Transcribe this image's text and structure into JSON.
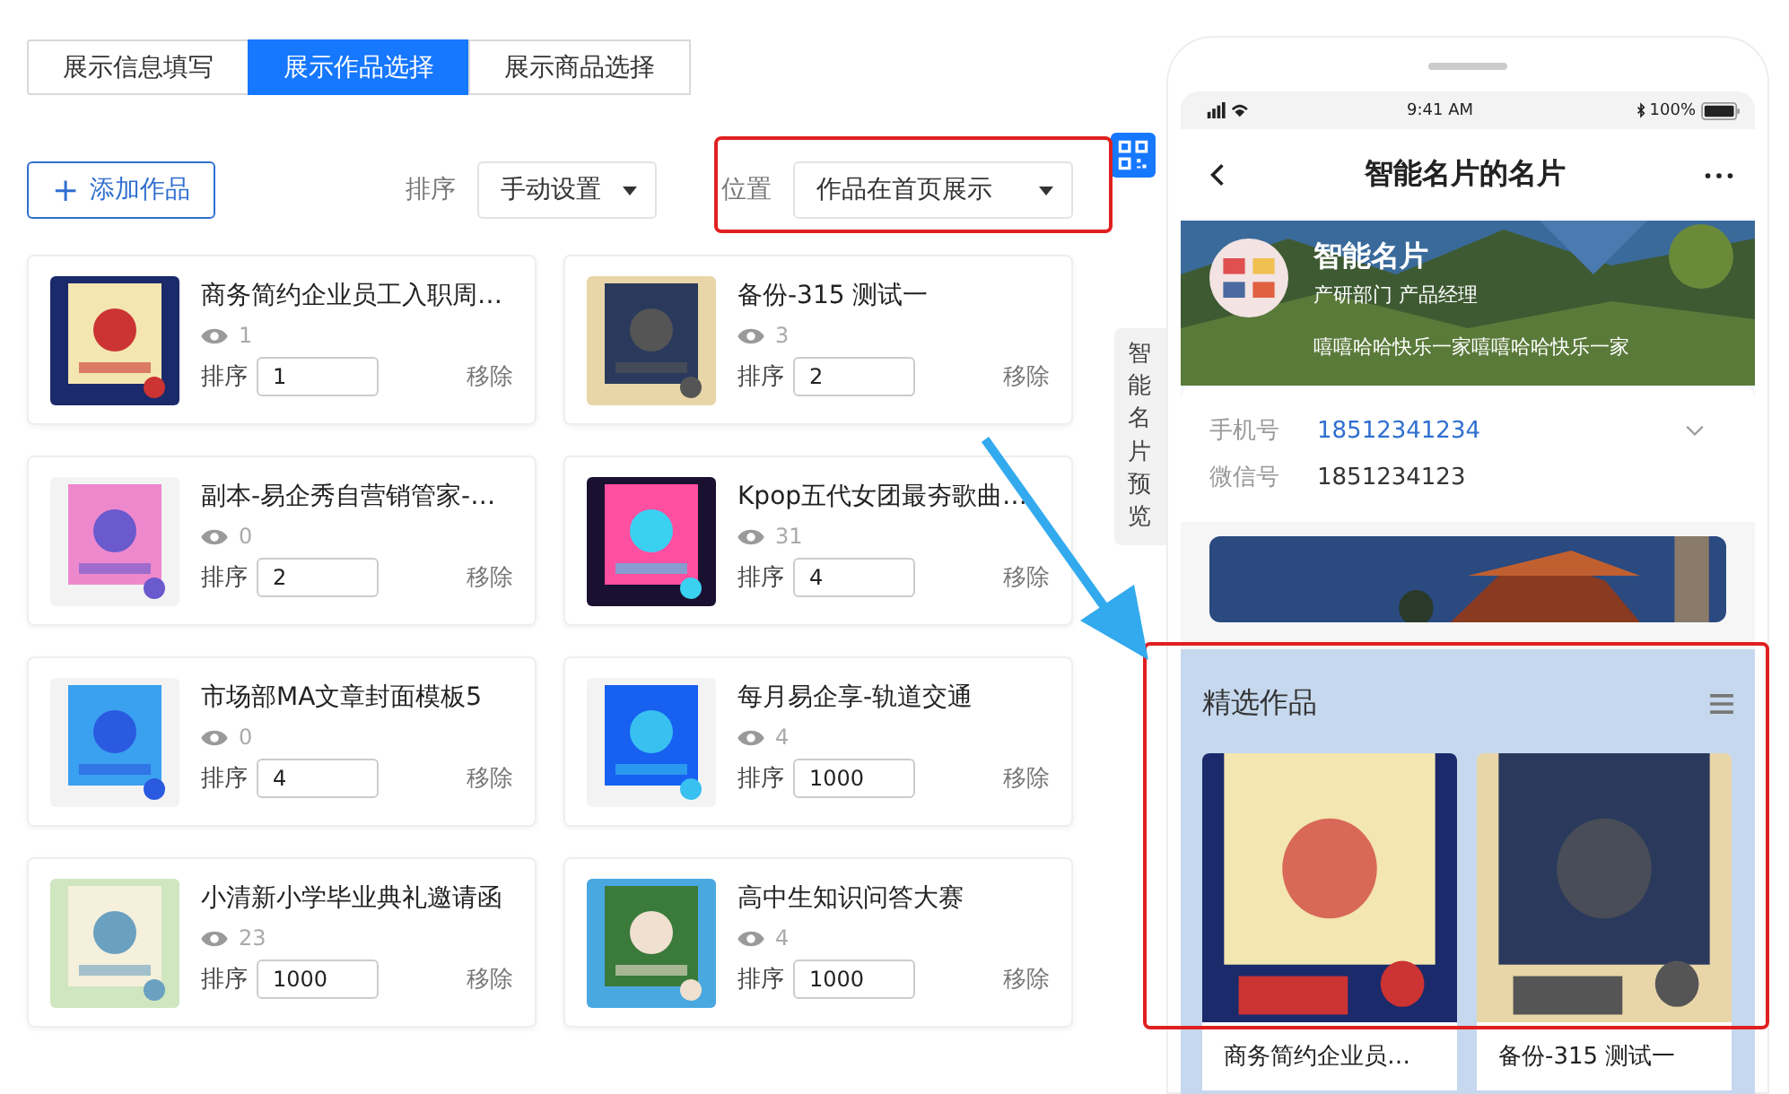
{
  "tabs": [
    {
      "label": "展示信息填写",
      "selected": false
    },
    {
      "label": "展示作品选择",
      "selected": true
    },
    {
      "label": "展示商品选择",
      "selected": false
    }
  ],
  "add_button": {
    "icon": "+",
    "label": "添加作品"
  },
  "sort": {
    "label": "排序",
    "value": "手动设置"
  },
  "position": {
    "label": "位置",
    "value": "作品在首页展示"
  },
  "works": [
    {
      "title": "商务简约企业员工入职周…",
      "views": "1",
      "order_label": "排序",
      "order": "1",
      "remove": "移除"
    },
    {
      "title": "备份-315 测试一",
      "views": "3",
      "order_label": "排序",
      "order": "2",
      "remove": "移除"
    },
    {
      "title": "副本-易企秀自营销管家-…",
      "views": "0",
      "order_label": "排序",
      "order": "2",
      "remove": "移除"
    },
    {
      "title": "Kpop五代女团最夯歌曲…",
      "views": "31",
      "order_label": "排序",
      "order": "4",
      "remove": "移除"
    },
    {
      "title": "市场部MA文章封面模板5",
      "views": "0",
      "order_label": "排序",
      "order": "4",
      "remove": "移除"
    },
    {
      "title": "每月易企享-轨道交通",
      "views": "4",
      "order_label": "排序",
      "order": "1000",
      "remove": "移除"
    },
    {
      "title": "小清新小学毕业典礼邀请函",
      "views": "23",
      "order_label": "排序",
      "order": "1000",
      "remove": "移除"
    },
    {
      "title": "高中生知识问答大赛",
      "views": "4",
      "order_label": "排序",
      "order": "1000",
      "remove": "移除"
    }
  ],
  "preview_tab": "智能名片预览",
  "phone": {
    "time": "9:41 AM",
    "battery": "100%",
    "title": "智能名片的名片",
    "profile": {
      "name": "智能名片",
      "role": "产研部门 产品经理",
      "motto": "嘻嘻哈哈快乐一家嘻嘻哈哈快乐一家"
    },
    "contacts": [
      {
        "label": "手机号",
        "value": "18512341234",
        "kind": "link"
      },
      {
        "label": "微信号",
        "value": "1851234123",
        "kind": "plain"
      }
    ],
    "featured": {
      "title": "精选作品",
      "items": [
        {
          "title": "商务简约企业员…"
        },
        {
          "title": "备份-315 测试一"
        }
      ]
    }
  }
}
